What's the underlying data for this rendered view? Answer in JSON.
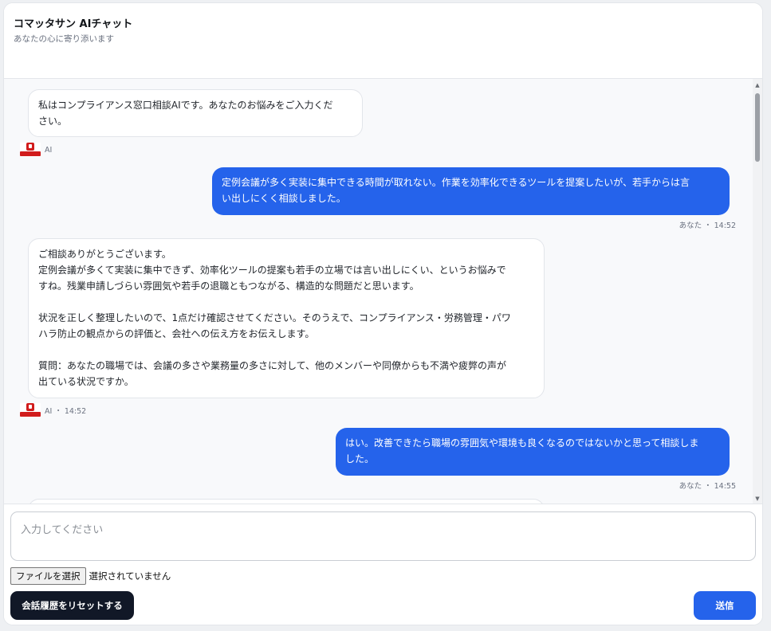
{
  "header": {
    "title": "コマッタサン AIチャット",
    "subtitle": "あなたの心に寄り添います"
  },
  "messages": [
    {
      "role": "ai",
      "text": "私はコンプライアンス窓口相談AIです。あなたのお悩みをご入力くだ\nさい。",
      "meta": "AI"
    },
    {
      "role": "user",
      "text": "定例会議が多く実装に集中できる時間が取れない。作業を効率化できるツールを提案したいが、若手からは言\nい出しにくく相談しました。",
      "meta": "あなた ・ 14:52"
    },
    {
      "role": "ai",
      "text": "ご相談ありがとうございます。\n定例会議が多くて実装に集中できず、効率化ツールの提案も若手の立場では言い出しにくい、というお悩みで\nすね。残業申請しづらい雰囲気や若手の退職ともつながる、構造的な問題だと思います。\n\n状況を正しく整理したいので、1点だけ確認させてください。そのうえで、コンプライアンス・労務管理・パワ\nハラ防止の観点からの評価と、会社への伝え方をお伝えします。\n\n質問：あなたの職場では、会議の多さや業務量の多さに対して、他のメンバーや同僚からも不満や疲弊の声が\n出ている状況ですか。",
      "meta": "AI ・ 14:52"
    },
    {
      "role": "user",
      "text": "はい。改善できたら職場の雰囲気や環境も良くなるのではないかと思って相談しま\nした。",
      "meta": "あなた ・ 14:55"
    }
  ],
  "composer": {
    "placeholder": "入力してください",
    "value": "",
    "file_button_label": "ファイルを選択",
    "file_status": "選択されていません",
    "reset_label": "会話履歴をリセットする",
    "send_label": "送信"
  },
  "colors": {
    "accent": "#2563eb",
    "dark_button": "#111827",
    "logo_red": "#d11c1c"
  },
  "icons": {
    "ai_avatar": "komattasan-logo-icon",
    "scroll_up": "triangle-up-icon",
    "scroll_down": "triangle-down-icon"
  }
}
